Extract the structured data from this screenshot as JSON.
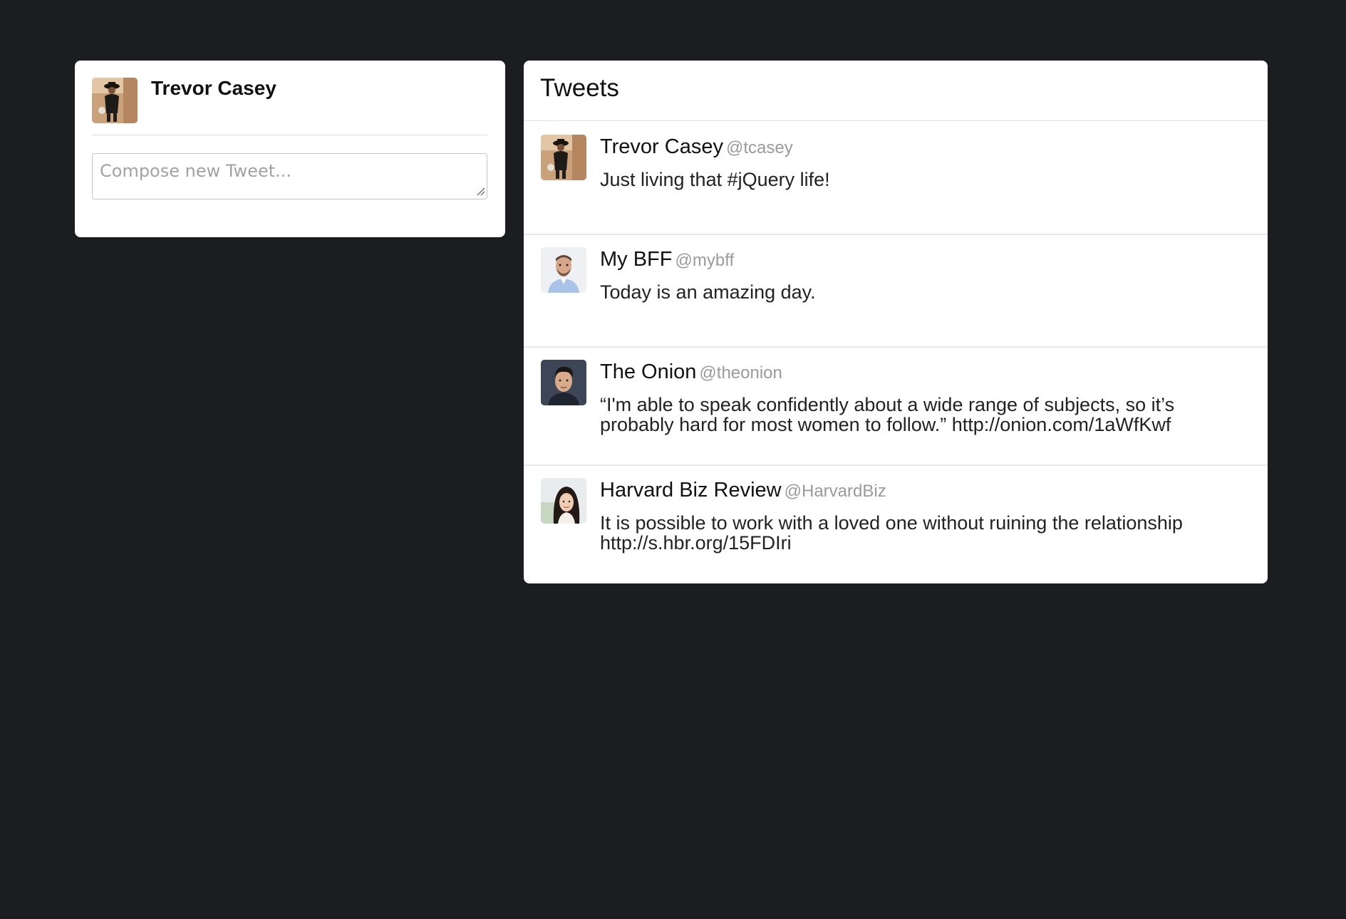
{
  "colors": {
    "background": "#1c1d21",
    "card": "#ffffff",
    "handle": "#9a9a9a"
  },
  "profile": {
    "name": "Trevor Casey",
    "avatar": "profile-photo"
  },
  "compose": {
    "placeholder": "Compose new Tweet...",
    "value": ""
  },
  "tweets_panel": {
    "title": "Tweets",
    "tweets": [
      {
        "name": "Trevor Casey",
        "handle": "@tcasey",
        "text": "Just living that #jQuery life!",
        "avatar": "profile-photo"
      },
      {
        "name": "My BFF",
        "handle": "@mybff",
        "text": "Today is an amazing day.",
        "avatar": "profile-photo"
      },
      {
        "name": "The Onion",
        "handle": "@theonion",
        "text": "“I'm able to speak confidently about a wide range of subjects, so it’s probably hard for most women to follow.” http://onion.com/1aWfKwf",
        "avatar": "profile-photo"
      },
      {
        "name": "Harvard Biz Review",
        "handle": "@HarvardBiz",
        "text": "It is possible to work with a loved one without ruining the relationship http://s.hbr.org/15FDIri",
        "avatar": "profile-photo"
      }
    ]
  }
}
